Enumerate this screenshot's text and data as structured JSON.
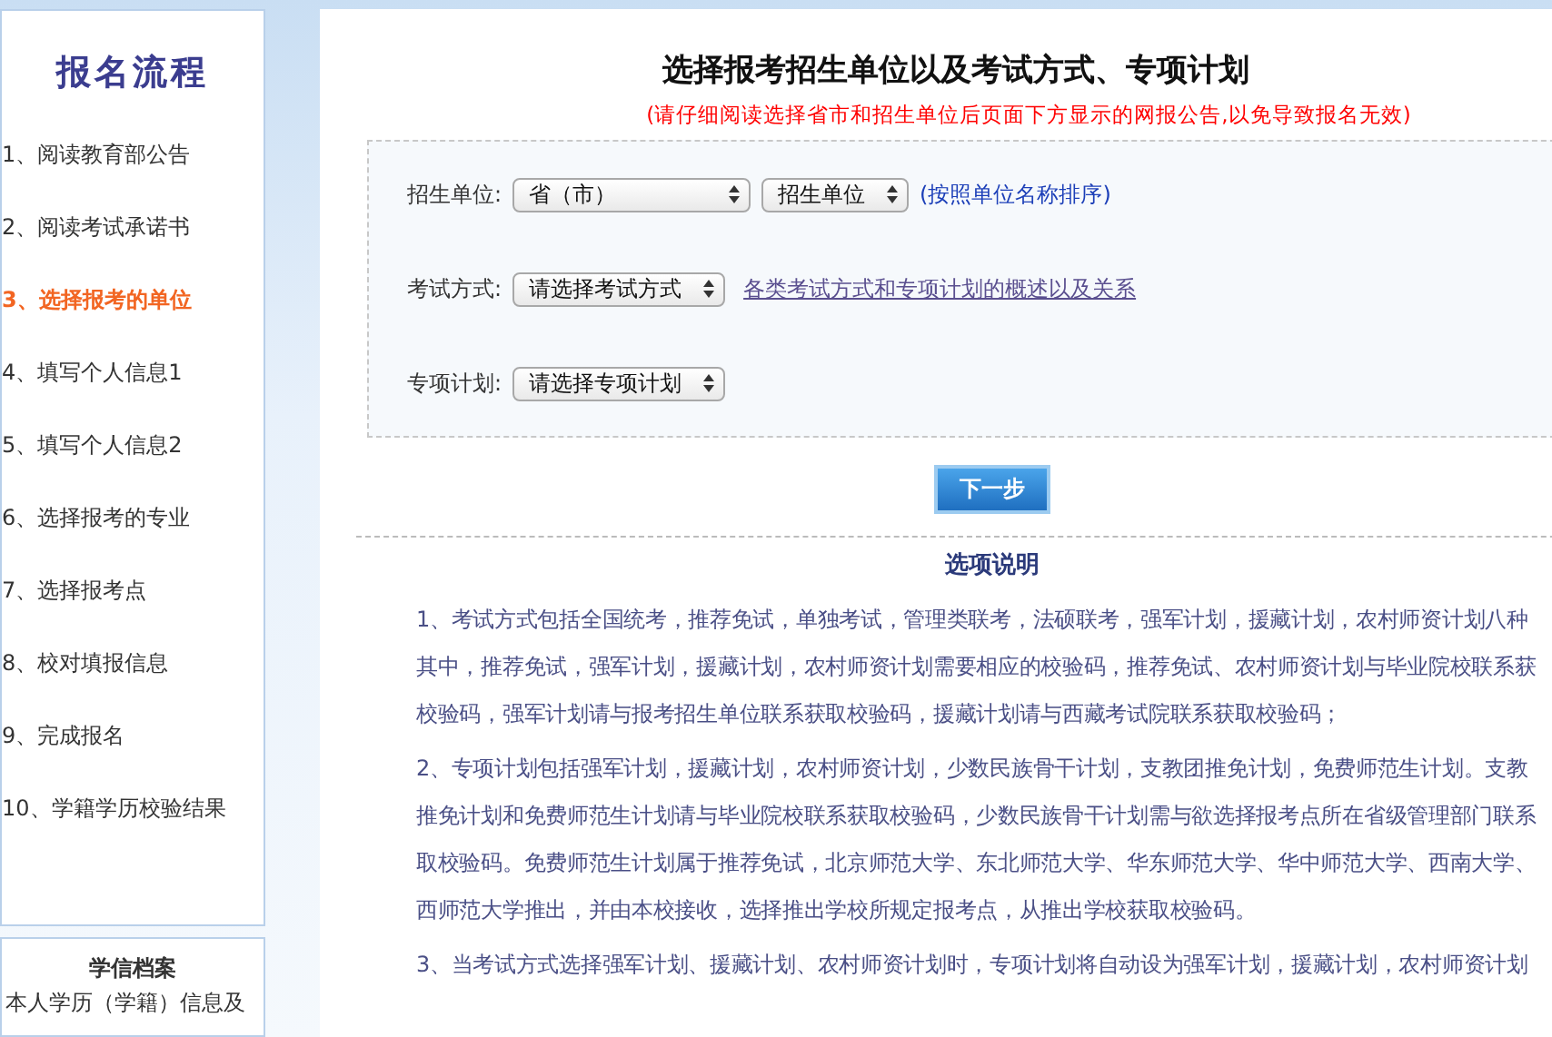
{
  "sidebar": {
    "title": "报名流程",
    "steps": [
      {
        "label": "1、阅读教育部公告",
        "selected": false
      },
      {
        "label": "2、阅读考试承诺书",
        "selected": false
      },
      {
        "label": "3、选择报考的单位",
        "selected": true
      },
      {
        "label": "4、填写个人信息1",
        "selected": false
      },
      {
        "label": "5、填写个人信息2",
        "selected": false
      },
      {
        "label": "6、选择报考的专业",
        "selected": false
      },
      {
        "label": "7、选择报考点",
        "selected": false
      },
      {
        "label": "8、校对填报信息",
        "selected": false
      },
      {
        "label": "9、完成报名",
        "selected": false
      },
      {
        "label": "10、学籍学历校验结果",
        "selected": false
      }
    ]
  },
  "archive": {
    "title": "学信档案",
    "text": "本人学历（学籍）信息及"
  },
  "main": {
    "title": "选择报考招生单位以及考试方式、专项计划",
    "notice": "(请仔细阅读选择省市和招生单位后页面下方显示的网报公告,以免导致报名无效)",
    "form": [
      {
        "label": "招生单位:",
        "selects": [
          "省（市）",
          "招生单位"
        ],
        "link": {
          "kind": "hint",
          "text": "(按照单位名称排序)"
        }
      },
      {
        "label": "考试方式:",
        "selects": [
          "请选择考试方式"
        ],
        "link": {
          "kind": "underlined",
          "text": "各类考试方式和专项计划的概述以及关系"
        }
      },
      {
        "label": "专项计划:",
        "selects": [
          "请选择专项计划"
        ]
      }
    ],
    "next_button": "下一步",
    "notes_title": "选项说明",
    "notes": [
      [
        "1、考试方式包括全国统考，推荐免试，单独考试，管理类联考，法硕联考，强军计划，援藏计划，农村师资计划八种",
        "其中，推荐免试，强军计划，援藏计划，农村师资计划需要相应的校验码，推荐免试、农村师资计划与毕业院校联系获",
        "校验码，强军计划请与报考招生单位联系获取校验码，援藏计划请与西藏考试院联系获取校验码；"
      ],
      [
        "2、专项计划包括强军计划，援藏计划，农村师资计划，少数民族骨干计划，支教团推免计划，免费师范生计划。支教",
        "推免计划和免费师范生计划请与毕业院校联系获取校验码，少数民族骨干计划需与欲选择报考点所在省级管理部门联系",
        "取校验码。免费师范生计划属于推荐免试，北京师范大学、东北师范大学、华东师范大学、华中师范大学、西南大学、",
        "西师范大学推出，并由本校接收，选择推出学校所规定报考点，从推出学校获取校验码。"
      ],
      [
        "3、当考试方式选择强军计划、援藏计划、农村师资计划时，专项计划将自动设为强军计划，援藏计划，农村师资计划"
      ]
    ]
  }
}
